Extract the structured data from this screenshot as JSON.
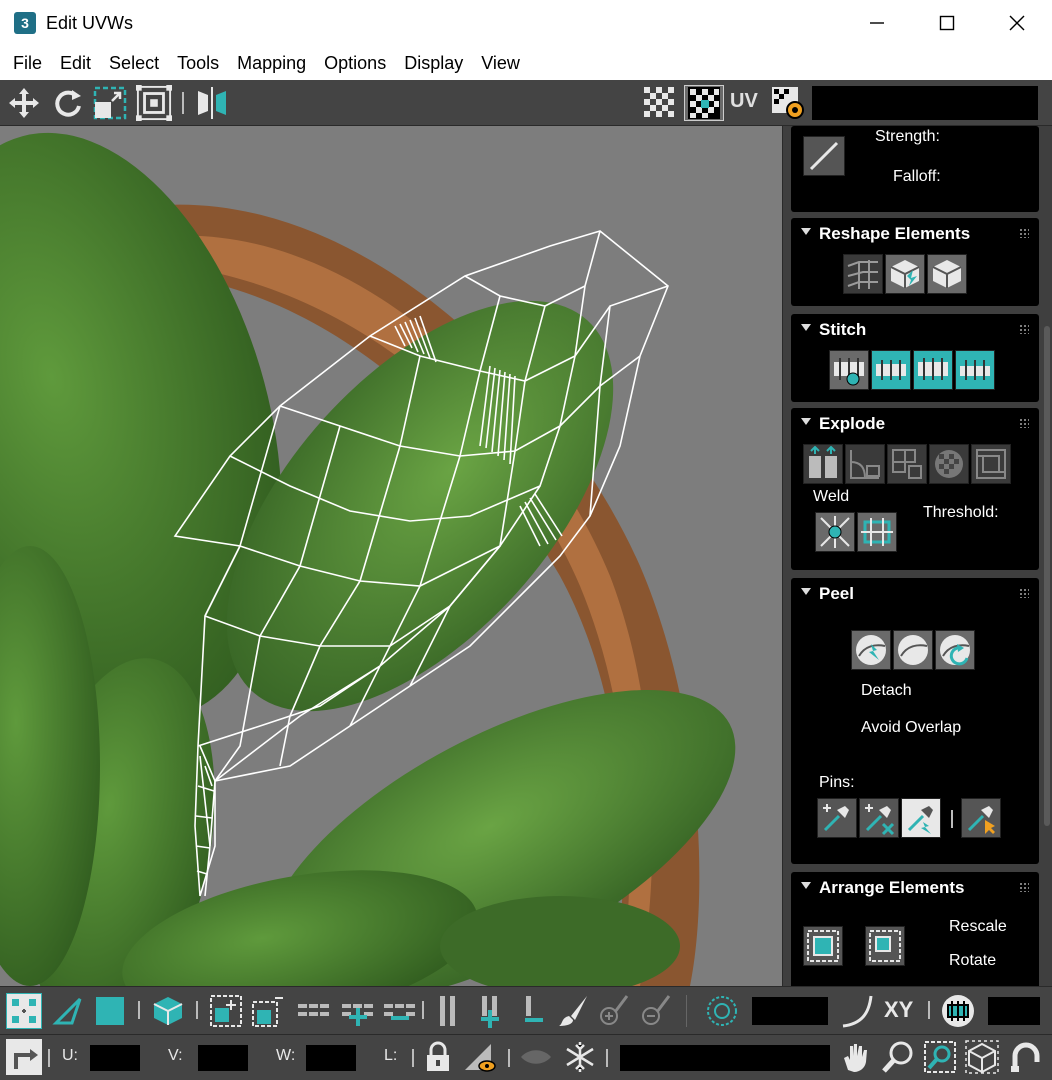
{
  "window": {
    "app_icon_text": "3",
    "title": "Edit UVWs",
    "minimize": "—",
    "maximize": "☐",
    "close": "✕"
  },
  "menu": [
    "File",
    "Edit",
    "Select",
    "Tools",
    "Mapping",
    "Options",
    "Display",
    "View"
  ],
  "toolbar_top": {
    "uv_label": "UV",
    "buttons": [
      "move-icon",
      "rotate-icon",
      "scale-icon",
      "freeform-icon",
      "mirror-icon",
      "checker-grid-icon",
      "checker-texture-icon",
      "uv-toggle",
      "settings-icon"
    ]
  },
  "panel": {
    "brush": {
      "strength_label": "Strength:",
      "falloff_label": "Falloff:"
    },
    "reshape_elements": {
      "title": "Reshape Elements",
      "buttons": [
        "straighten-icon",
        "relax-icon",
        "relax-settings-icon"
      ]
    },
    "stitch": {
      "title": "Stitch",
      "buttons": [
        "stitch-custom-icon",
        "stitch-source-icon",
        "stitch-average-icon",
        "stitch-target-icon"
      ]
    },
    "explode": {
      "title": "Explode",
      "buttons": [
        "break-icon",
        "flatten-by-angle-icon",
        "flatten-by-polygon-icon",
        "flatten-by-material-icon",
        "flatten-by-smoothing-icon"
      ],
      "weld_label": "Weld",
      "threshold_label": "Threshold:",
      "weld_buttons": [
        "weld-target-icon",
        "weld-selected-icon"
      ]
    },
    "peel": {
      "title": "Peel",
      "buttons": [
        "quick-peel-icon",
        "peel-mode-icon",
        "reset-peel-icon"
      ],
      "detach_label": "Detach",
      "avoid_overlap_label": "Avoid Overlap",
      "pins_label": "Pins:",
      "pin_buttons": [
        "pin-icon",
        "unpin-icon",
        "auto-pin-icon",
        "select-pins-icon"
      ]
    },
    "arrange_elements": {
      "title": "Arrange Elements",
      "rescale_label": "Rescale",
      "rotate_label": "Rotate",
      "buttons": [
        "pack-custom-icon",
        "pack-normalize-icon"
      ]
    }
  },
  "bottom1": {
    "xy_label": "XY",
    "buttons": [
      "vertex-mode-icon",
      "edge-mode-icon",
      "face-mode-icon",
      "element-mode-icon",
      "grow-selection-icon",
      "shrink-selection-icon",
      "loop-icon",
      "loop-grow-icon",
      "loop-shrink-icon",
      "ring-icon",
      "ring-grow-icon",
      "ring-shrink-icon",
      "paint-select-icon",
      "paint-grow-icon",
      "paint-shrink-icon",
      "soft-select-icon",
      "falloff-curve-icon",
      "coordinate-space-icon"
    ]
  },
  "bottom2": {
    "u_label": "U:",
    "v_label": "V:",
    "w_label": "W:",
    "l_label": "L:",
    "buttons": [
      "transform-mode-icon",
      "lock-icon",
      "filter-selected-icon",
      "hide-icon",
      "freeze-icon",
      "pan-icon",
      "zoom-icon",
      "zoom-region-icon",
      "zoom-extents-icon",
      "snap-icon"
    ]
  },
  "colors": {
    "accent": "#2fb4b4",
    "panel_bg": "#3f3f3f",
    "rollout_bg": "#000000",
    "viewport_bg": "#7d7d7d"
  }
}
